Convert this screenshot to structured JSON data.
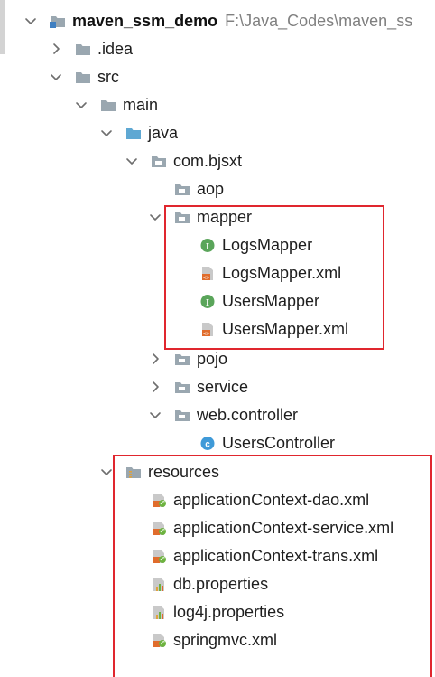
{
  "root": {
    "name": "maven_ssm_demo",
    "path": "F:\\Java_Codes\\maven_ss"
  },
  "nodes": {
    "idea": ".idea",
    "src": "src",
    "main": "main",
    "java": "java",
    "package": "com.bjsxt",
    "aop": "aop",
    "mapper": "mapper",
    "logs_mapper": "LogsMapper",
    "logs_mapper_xml": "LogsMapper.xml",
    "users_mapper": "UsersMapper",
    "users_mapper_xml": "UsersMapper.xml",
    "pojo": "pojo",
    "service": "service",
    "web_controller": "web.controller",
    "users_controller": "UsersController",
    "resources": "resources",
    "app_ctx_dao": "applicationContext-dao.xml",
    "app_ctx_service": "applicationContext-service.xml",
    "app_ctx_trans": "applicationContext-trans.xml",
    "db_properties": "db.properties",
    "log4j_properties": "log4j.properties",
    "springmvc": "springmvc.xml"
  },
  "icon_badges": {
    "interface": "I",
    "class": "c"
  },
  "colors": {
    "highlight": "#e0262e",
    "folder": "#9aa7b0",
    "source_folder": "#5fa8d3",
    "interface_badge": "#5aa55a",
    "class_badge": "#3f9ad8",
    "xml_orange": "#e06c2c",
    "spring_green": "#6db33f"
  },
  "icons": {
    "collapsed": "chevron-right-icon",
    "expanded": "chevron-down-icon",
    "module": "module-folder-icon",
    "folder": "folder-icon",
    "source_root": "source-root-folder-icon",
    "resources_root": "resources-root-folder-icon",
    "package": "package-icon",
    "interface": "java-interface-icon",
    "class": "java-class-icon",
    "mybatis_xml": "mybatis-xml-icon",
    "spring_xml": "spring-xml-icon",
    "properties": "properties-file-icon"
  }
}
